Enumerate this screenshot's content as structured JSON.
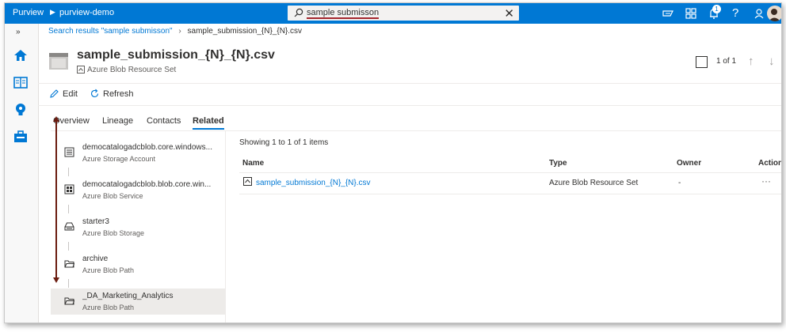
{
  "topbar": {
    "brand": "Purview",
    "workspace": "purview-demo",
    "search_value": "sample submisson",
    "notification_count": "1"
  },
  "breadcrumb": {
    "link": "Search results \"sample submisson\"",
    "current": "sample_submission_{N}_{N}.csv"
  },
  "asset": {
    "title": "sample_submission_{N}_{N}.csv",
    "type": "Azure Blob Resource Set",
    "pager": "1 of 1"
  },
  "toolbar": {
    "edit_label": "Edit",
    "refresh_label": "Refresh"
  },
  "tabs": [
    {
      "label": "Overview"
    },
    {
      "label": "Lineage"
    },
    {
      "label": "Contacts"
    },
    {
      "label": "Related"
    }
  ],
  "lineage": [
    {
      "name": "democatalogadcblob.core.windows...",
      "type": "Azure Storage Account",
      "icon": "storage-account-icon"
    },
    {
      "name": "democatalogadcblob.blob.core.win...",
      "type": "Azure Blob Service",
      "icon": "blob-service-icon"
    },
    {
      "name": "starter3",
      "type": "Azure Blob Storage",
      "icon": "container-icon"
    },
    {
      "name": "archive",
      "type": "Azure Blob Path",
      "icon": "folder-icon"
    },
    {
      "name": "_DA_Marketing_Analytics",
      "type": "Azure Blob Path",
      "icon": "folder-icon"
    }
  ],
  "results": {
    "showing": "Showing 1 to 1 of 1 items",
    "columns": [
      "Name",
      "Type",
      "Owner",
      "Actions"
    ],
    "rows": [
      {
        "name": "sample_submission_{N}_{N}.csv",
        "type": "Azure Blob Resource Set",
        "owner": "-",
        "actions": "···"
      }
    ]
  },
  "colors": {
    "brand": "#0078d4",
    "annotation_arrow": "#6b1c10"
  }
}
